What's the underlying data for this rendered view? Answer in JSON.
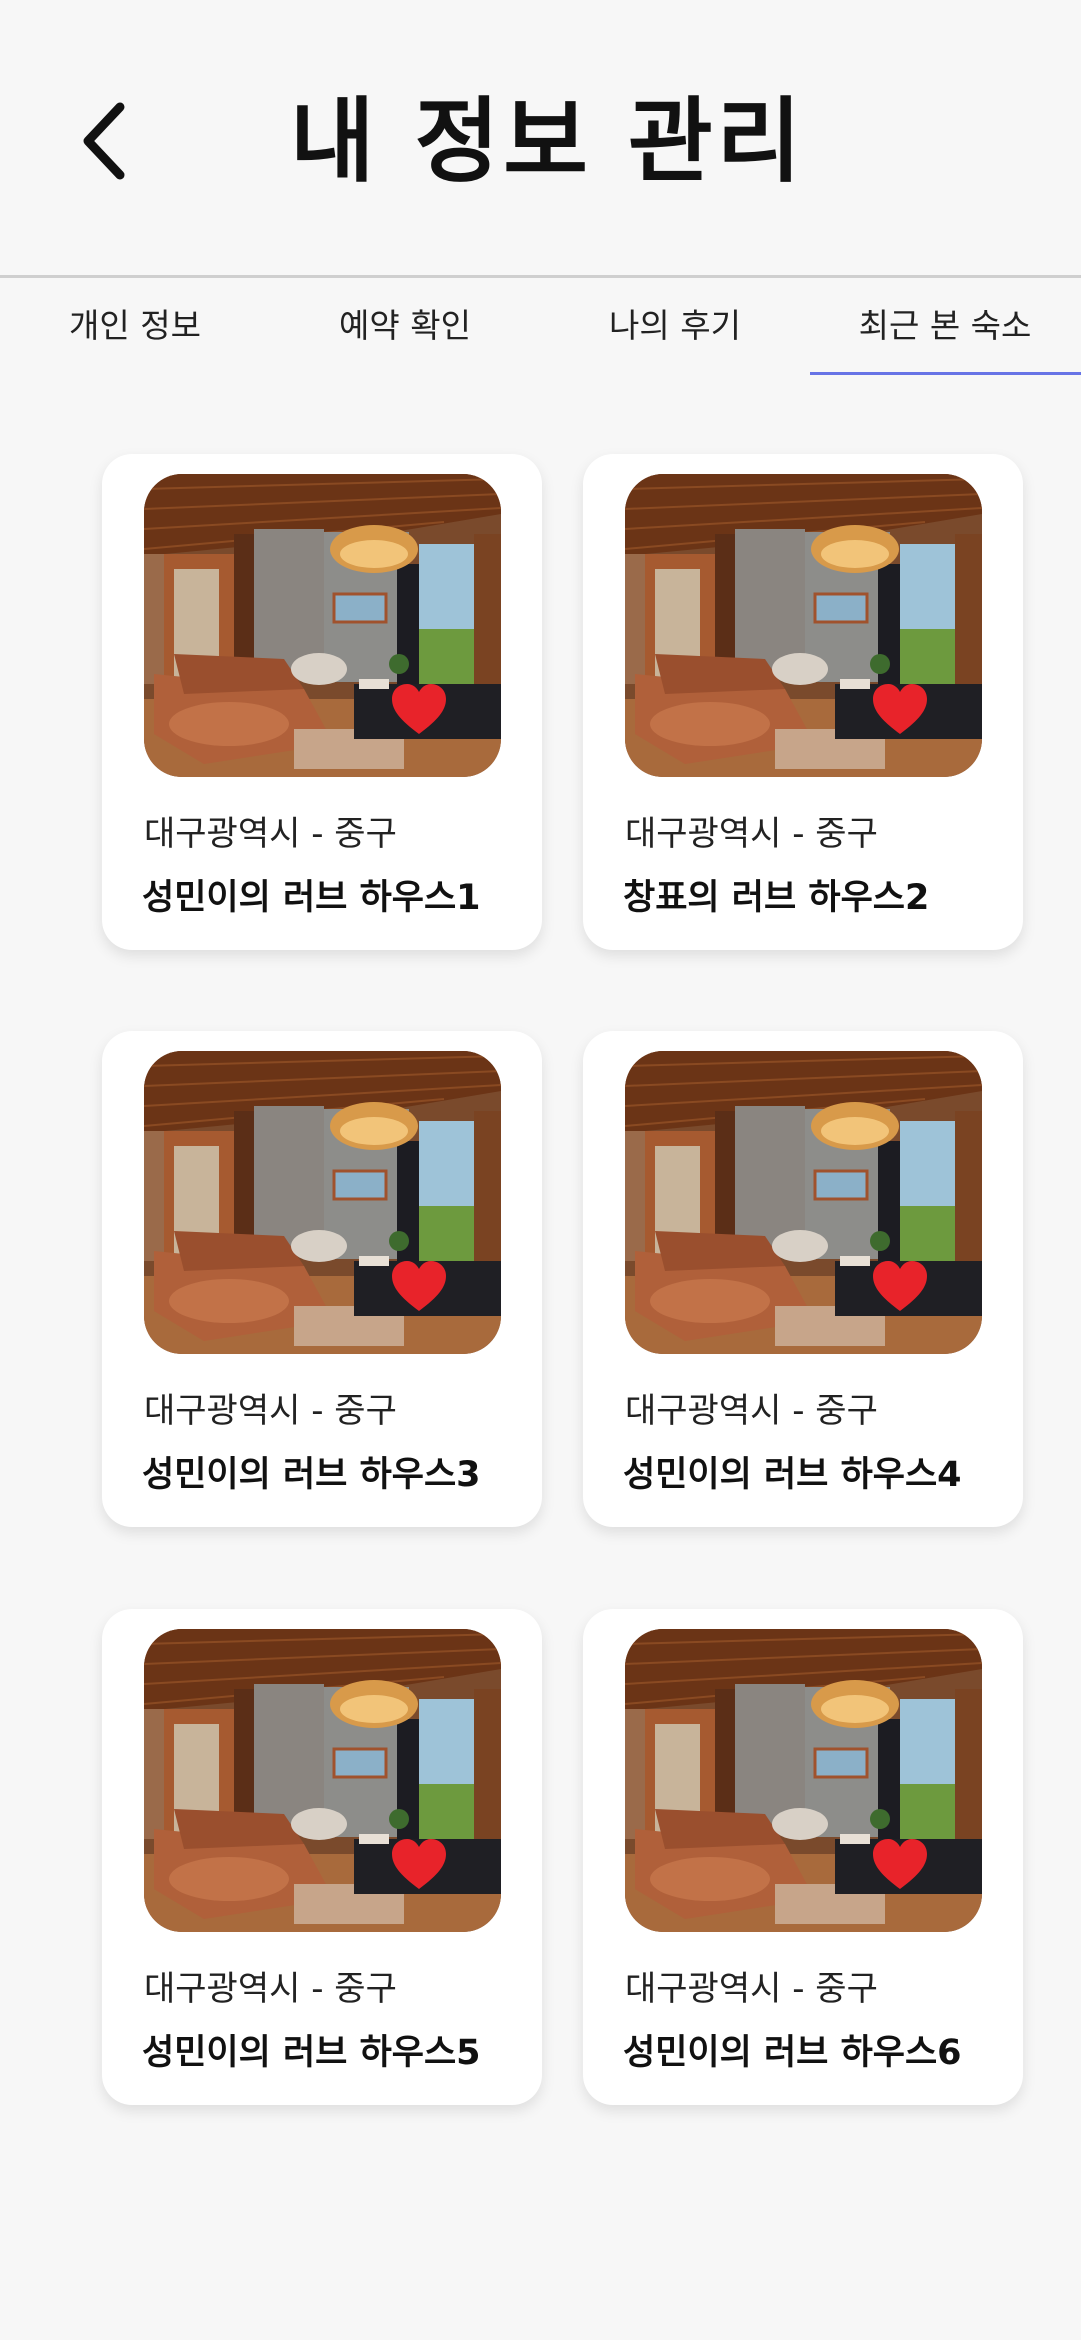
{
  "header": {
    "title": "내 정보 관리",
    "back_icon": "chevron-left-icon"
  },
  "tabs": [
    {
      "label": "개인 정보",
      "active": false
    },
    {
      "label": "예약 확인",
      "active": false
    },
    {
      "label": "나의 후기",
      "active": false
    },
    {
      "label": "최근 본 숙소",
      "active": true
    }
  ],
  "accent_color": "#6774e6",
  "heart_color": "#e8232a",
  "listings": [
    {
      "location": "대구광역시 - 중구",
      "name": "성민이의 러브 하우스1",
      "liked": true
    },
    {
      "location": "대구광역시 - 중구",
      "name": "창표의 러브 하우스2",
      "liked": true
    },
    {
      "location": "대구광역시 - 중구",
      "name": "성민이의 러브 하우스3",
      "liked": true
    },
    {
      "location": "대구광역시 - 중구",
      "name": "성민이의 러브 하우스4",
      "liked": true
    },
    {
      "location": "대구광역시 - 중구",
      "name": "성민이의 러브 하우스5",
      "liked": true
    },
    {
      "location": "대구광역시 - 중구",
      "name": "성민이의 러브 하우스6",
      "liked": true
    }
  ]
}
